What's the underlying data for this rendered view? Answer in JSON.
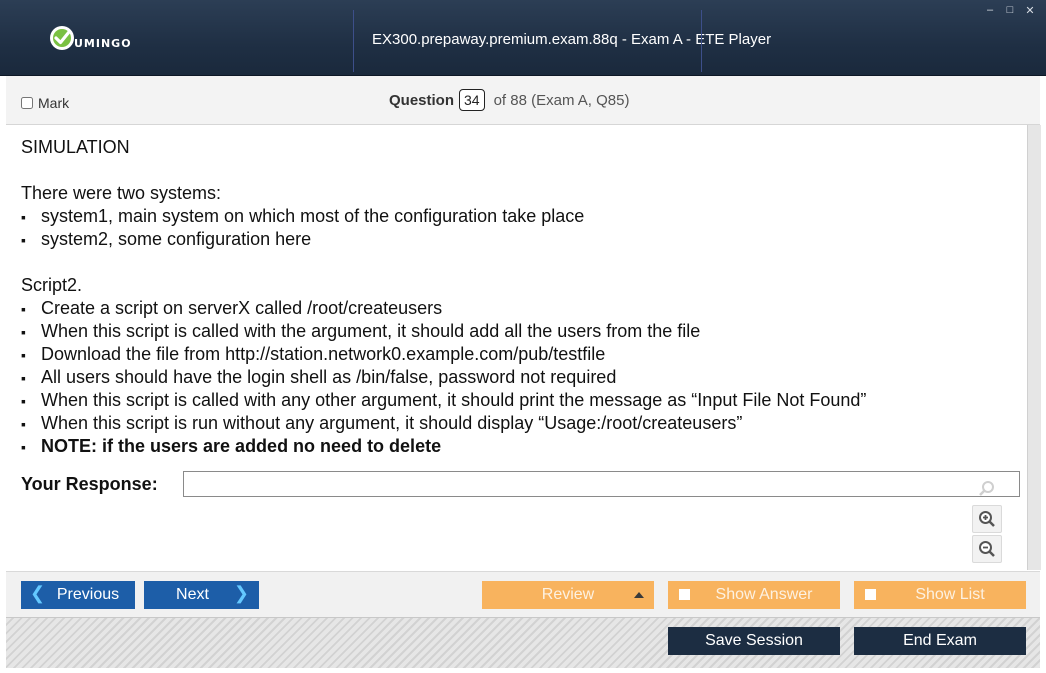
{
  "window": {
    "title": "EX300.prepaway.premium.exam.88q - Exam A - ETE Player",
    "logo_text": "UMINGO",
    "controls": [
      "–",
      "□",
      "✕"
    ]
  },
  "header": {
    "mark_label": "Mark",
    "question_label": "Question",
    "question_number": "34",
    "question_of": "of 88 (Exam A, Q85)"
  },
  "question": {
    "heading": "SIMULATION",
    "intro": "There were two systems:",
    "systems": [
      "system1, main system on which most of the configuration take place",
      "system2, some configuration here"
    ],
    "script_title": "Script2.",
    "script_items": [
      "Create a script on serverX called /root/createusers",
      "When this script is called with the argument, it should add all the users from the file",
      "Download the file from http://station.network0.example.com/pub/testfile",
      "All users should have the login shell as /bin/false, password not required",
      "When this script is called with any other argument, it should print the message as “Input File Not Found”",
      "When this script is run without any argument, it should display “Usage:/root/createusers”"
    ],
    "note": "NOTE: if the users are added no need to delete",
    "bullet_char": "▪",
    "response_label": "Your Response:",
    "response_value": ""
  },
  "nav": {
    "previous_label": "Previous",
    "next_label": "Next",
    "review_label": "Review",
    "show_answer_label": "Show Answer",
    "show_list_label": "Show List"
  },
  "footer": {
    "save_session_label": "Save Session",
    "end_exam_label": "End Exam"
  },
  "colors": {
    "nav_blue": "#1d5ea8",
    "nav_orange": "#f8b35e",
    "footer_dark": "#1c2d42",
    "titlebar": "#1f2f44",
    "logo_green": "#7ac142"
  }
}
